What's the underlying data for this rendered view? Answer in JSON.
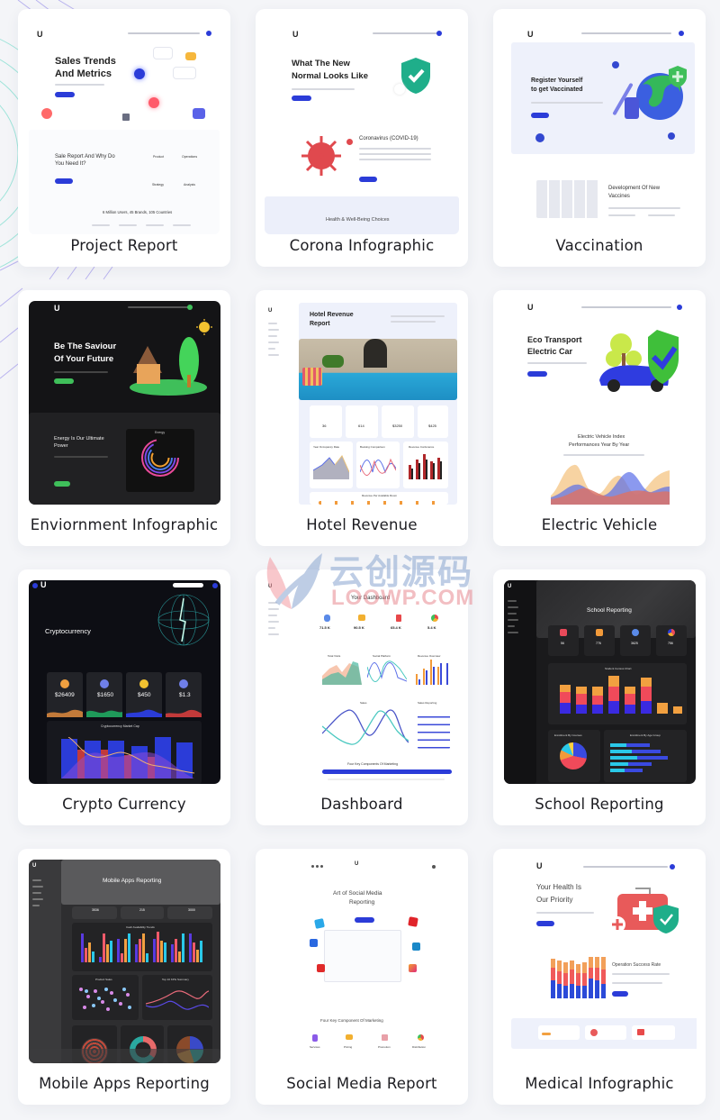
{
  "cards": [
    {
      "label": "Project Report",
      "hero_title_1": "Sales Trends",
      "hero_title_2": "And Metrics",
      "section_title_1": "Sale Report And Why Do",
      "section_title_2": "You Need It?",
      "features": [
        "Product",
        "Operations",
        "Strategy",
        "Analysis"
      ],
      "stats": "6 Million Users, 45 Brands, 105 Countries"
    },
    {
      "label": "Corona Infographic",
      "hero_title_1": "What The New",
      "hero_title_2": "Normal Looks Like",
      "section_title": "Coronavirus (COVID-19)",
      "footer_title": "Health & Well-Being Choices"
    },
    {
      "label": "Vaccination",
      "hero_title_1": "Register Yourself",
      "hero_title_2": "to get Vaccinated",
      "section_title_1": "Development Of New",
      "section_title_2": "Vaccines"
    },
    {
      "label": "Enviornment Infographic",
      "hero_title_1": "Be The Saviour",
      "hero_title_2": "Of Your Future",
      "section_title_1": "Energy Is Our Ultimate",
      "section_title_2": "Power",
      "chart_title": "Energy"
    },
    {
      "label": "Hotel Revenue",
      "hero_title_1": "Hotel Revenue",
      "hero_title_2": "Report",
      "stats": [
        "36",
        "614",
        "$3250",
        "$425"
      ],
      "charts": [
        "Year Occupancy Rate",
        "Booking Comparison",
        "Revenue Conference"
      ],
      "bottom_chart": "Revenue Per Available Room"
    },
    {
      "label": "Electric Vehicle",
      "hero_title_1": "Eco Transport",
      "hero_title_2": "Electric Car",
      "section_title_1": "Electric Vehicle Index",
      "section_title_2": "Performances Year By Year"
    },
    {
      "label": "Crypto Currency",
      "hero_title": "Cryptocurrency",
      "prices": [
        "$26409",
        "$1650",
        "$450",
        "$1.3"
      ],
      "price_colors": [
        "#f0a040",
        "#6f7fe8",
        "#f2c230",
        "#6f7fe8"
      ],
      "spark_colors": [
        "#c27a3a",
        "#1f9a5a",
        "#2b3cd8",
        "#c23a3a"
      ],
      "chart_title": "Cryptocurrency Market Cap"
    },
    {
      "label": "Dashboard",
      "hero_title": "Your Dashboard",
      "stats": [
        "71.5 K",
        "90.5 K",
        "65.4 K",
        "5.4 K"
      ],
      "charts": [
        "Total Visits",
        "Social Platform",
        "Revenue Overview"
      ],
      "wide_chart": "Sales",
      "side_chart": "Sales Reporting",
      "table_title": "Four Key Components Of Marketing"
    },
    {
      "label": "School Reporting",
      "hero_title": "School Reporting",
      "stats": [
        "56",
        "776",
        "3625",
        "756"
      ],
      "chart_title": "Student Census Chart",
      "pie_title": "Enrollment By Courses",
      "bar_title": "Enrollment By Age Group"
    },
    {
      "label": "Mobile Apps Reporting",
      "hero_title": "Mobile Apps Reporting",
      "stats": [
        "3536",
        "215",
        "3000"
      ],
      "chart_title": "Cash Availability Trends",
      "scatter_title": "Product Sales",
      "line_title": "Top 10 KPIs Summary"
    },
    {
      "label": "Social Media Report",
      "hero_title_1": "Art of Social Media",
      "hero_title_2": "Reporting",
      "section_title": "Four Key Component Of Marketing",
      "features": [
        "Services",
        "Pricing",
        "Promotion",
        "Distribution"
      ]
    },
    {
      "label": "Medical Infographic",
      "hero_title_1": "Your Health Is",
      "hero_title_2": "Our Priority",
      "section_title": "Operation Success Rate"
    }
  ],
  "watermark": {
    "cn": "云创源码",
    "en": "LOOWP.COM"
  }
}
